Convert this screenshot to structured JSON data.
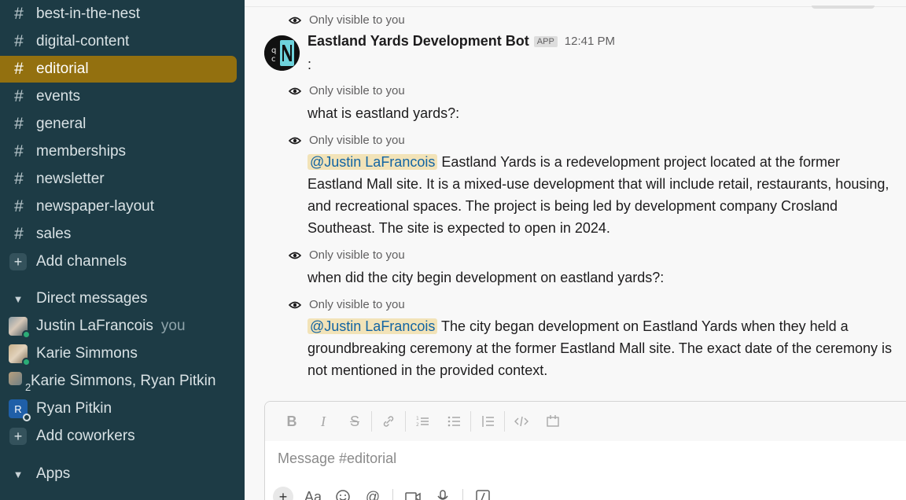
{
  "sidebar": {
    "channels": [
      {
        "name": "best-in-the-nest",
        "active": false
      },
      {
        "name": "digital-content",
        "active": false
      },
      {
        "name": "editorial",
        "active": true
      },
      {
        "name": "events",
        "active": false
      },
      {
        "name": "general",
        "active": false
      },
      {
        "name": "memberships",
        "active": false
      },
      {
        "name": "newsletter",
        "active": false
      },
      {
        "name": "newspaper-layout",
        "active": false
      },
      {
        "name": "sales",
        "active": false
      }
    ],
    "add_channels": "Add channels",
    "dm_section": "Direct messages",
    "dms": [
      {
        "name": "Justin LaFrancois",
        "suffix": "you"
      },
      {
        "name": "Karie Simmons"
      },
      {
        "name": "Karie Simmons, Ryan Pitkin",
        "count": "2"
      },
      {
        "name": "Ryan Pitkin",
        "initial": "R"
      }
    ],
    "add_coworkers": "Add coworkers",
    "apps_section": "Apps",
    "colors": {
      "bg": "#1d3b45",
      "active": "#93700f"
    }
  },
  "messages": {
    "visibility_note": "Only visible to you",
    "bot": {
      "name": "Eastland Yards Development Bot",
      "badge": "APP",
      "time": "12:41 PM",
      "first_text": ":"
    },
    "entries": [
      {
        "text": "what is eastland yards?:"
      },
      {
        "mention": "@Justin LaFrancois",
        "text": " Eastland Yards is a redevelopment project located at the former Eastland Mall site. It is a mixed-use development that will include retail, restaurants, housing, and recreational spaces. The project is being led by development company Crosland Southeast. The site is expected to open in 2024."
      },
      {
        "text": "when did the city begin development on eastland yards?:"
      },
      {
        "mention": "@Justin LaFrancois",
        "text": " The city began development on Eastland Yards when they held a groundbreaking ceremony at the former Eastland Mall site. The exact date of the ceremony is not mentioned in the provided context."
      }
    ]
  },
  "composer": {
    "placeholder": "Message #editorial",
    "format_buttons": [
      "bold-icon",
      "italic-icon",
      "strikethrough-icon",
      "link-icon",
      "ordered-list-icon",
      "bulleted-list-icon",
      "blockquote-icon",
      "code-icon",
      "code-block-icon"
    ],
    "bottom_buttons": [
      "plus-icon",
      "text-format-icon",
      "emoji-icon",
      "mention-icon",
      "video-icon",
      "microphone-icon",
      "slash-command-icon"
    ],
    "text_format_label": "Aa"
  }
}
